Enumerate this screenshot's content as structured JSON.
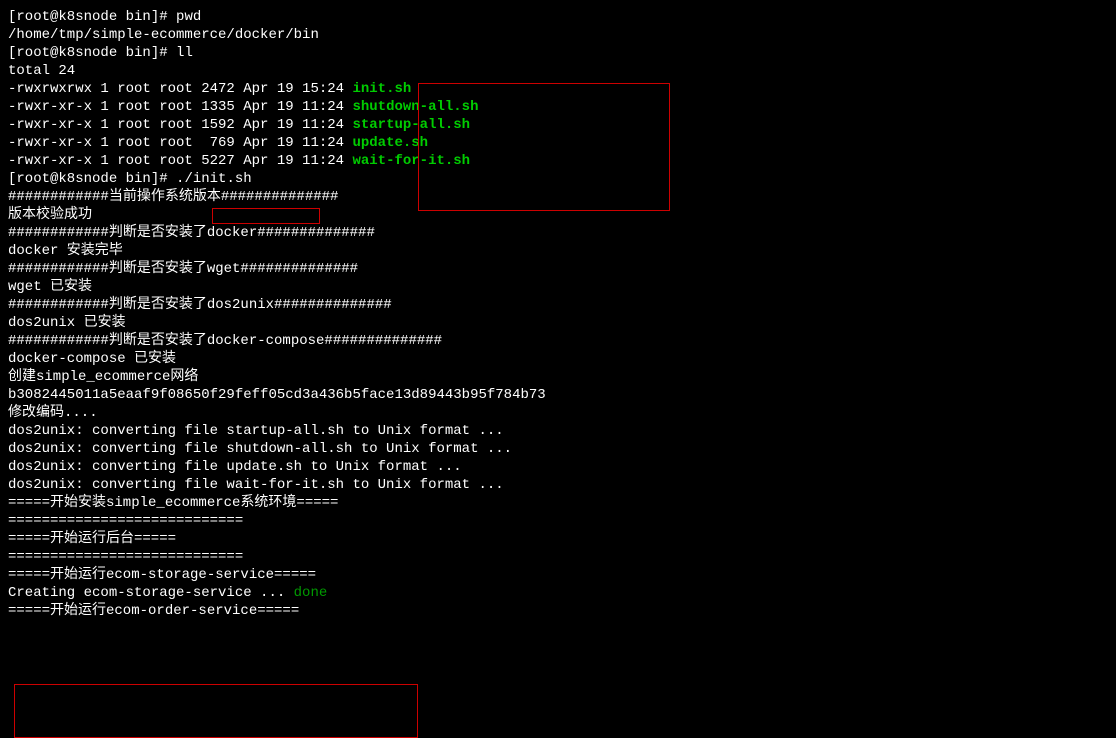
{
  "prompt": "[root@k8snode bin]#",
  "cmd_pwd": "pwd",
  "pwd_output": "/home/tmp/simple-ecommerce/docker/bin",
  "cmd_ll": "ll",
  "ll_total": "total 24",
  "files": [
    {
      "perms": "-rwxrwxrwx 1 root root 2472 Apr 19 15:24 ",
      "name": "init.sh"
    },
    {
      "perms": "-rwxr-xr-x 1 root root 1335 Apr 19 11:24 ",
      "name": "shutdown-all.sh"
    },
    {
      "perms": "-rwxr-xr-x 1 root root 1592 Apr 19 11:24 ",
      "name": "startup-all.sh"
    },
    {
      "perms": "-rwxr-xr-x 1 root root  769 Apr 19 11:24 ",
      "name": "update.sh"
    },
    {
      "perms": "-rwxr-xr-x 1 root root 5227 Apr 19 11:24 ",
      "name": "wait-for-it.sh"
    }
  ],
  "cmd_init": " ./init.sh",
  "out": {
    "l1": "############当前操作系统版本##############",
    "l2": "版本校验成功",
    "l3": "############判断是否安装了docker##############",
    "l4": "docker 安装完毕",
    "l5": "############判断是否安装了wget##############",
    "l6": "wget 已安装",
    "l7": "############判断是否安装了dos2unix##############",
    "l8": "dos2unix 已安装",
    "l9": "############判断是否安装了docker-compose##############",
    "l10": "docker-compose 已安装",
    "l11": "创建simple_ecommerce网络",
    "l12": "b3082445011a5eaaf9f08650f29feff05cd3a436b5face13d89443b95f784b73",
    "l13": "修改编码....",
    "l14": "dos2unix: converting file startup-all.sh to Unix format ...",
    "l15": "dos2unix: converting file shutdown-all.sh to Unix format ...",
    "l16": "dos2unix: converting file update.sh to Unix format ...",
    "l17": "dos2unix: converting file wait-for-it.sh to Unix format ...",
    "l18": "=====开始安装simple_ecommerce系统环境=====",
    "l19": "============================",
    "l20": "=====开始运行后台=====",
    "l21": "============================",
    "l22": "=====开始运行ecom-storage-service=====",
    "l23a": "Creating ecom-storage-service ... ",
    "l23b": "done",
    "l24": "=====开始运行ecom-order-service====="
  }
}
